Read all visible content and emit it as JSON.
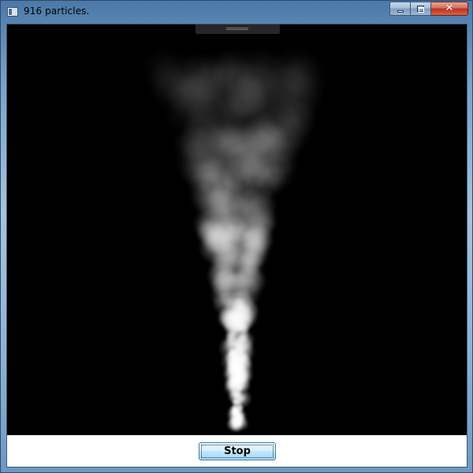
{
  "window": {
    "title": "916 particles.",
    "icon": "app-window-icon",
    "caption_buttons": {
      "minimize_icon": "minimize-icon",
      "maximize_icon": "maximize-icon",
      "close_icon": "close-icon",
      "close_glyph": "✕"
    }
  },
  "canvas": {
    "background_color": "#000000",
    "particle_color": "#ffffff"
  },
  "controls": {
    "stop_label": "Stop"
  }
}
